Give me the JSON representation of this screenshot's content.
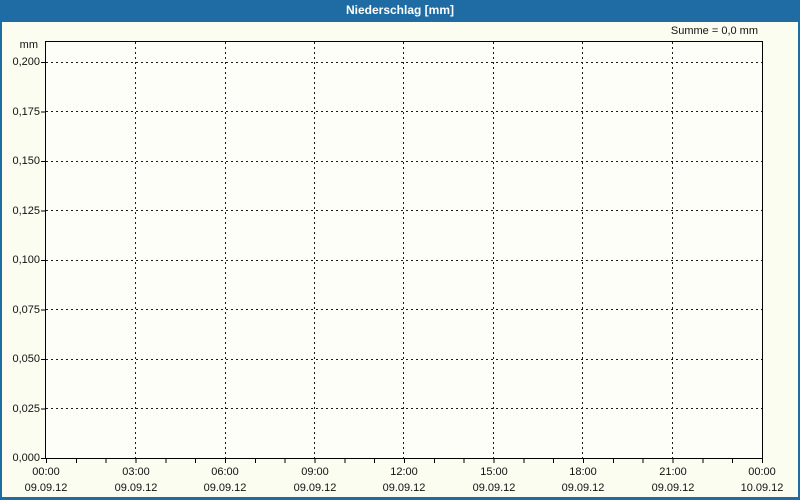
{
  "window": {
    "title": "Niederschlag [mm]"
  },
  "summary": {
    "text": "Summe = 0,0 mm"
  },
  "colors": {
    "accent_blue": "#1e6ca3",
    "content_background": "#fbfdf1",
    "plot_background": "#fdfef8",
    "grid": "#1a1a1a",
    "text": "#111111"
  },
  "chart_data": {
    "type": "bar",
    "title": "Niederschlag [mm]",
    "ylabel": "mm",
    "ylim": [
      0.0,
      0.2
    ],
    "y_tick_step": 0.025,
    "grid": "dashed major grid, horizontal every 0,025 mm, vertical every 3 hours; minor hourly tick marks on x axis",
    "legend_position": "none",
    "x_range": [
      "09.09.12 00:00",
      "10.09.12 00:00"
    ],
    "values": [],
    "sum_mm": "0,0",
    "note": "No precipitation recorded in the period; plot area is empty and Summe = 0,0 mm",
    "y_tick_labels_desc": [
      "0,200",
      "0,175",
      "0,150",
      "0,125",
      "0,100",
      "0,075",
      "0,050",
      "0,025",
      "0,000"
    ],
    "x_ticks": [
      {
        "time": "00:00",
        "date": "09.09.12"
      },
      {
        "time": "03:00",
        "date": "09.09.12"
      },
      {
        "time": "06:00",
        "date": "09.09.12"
      },
      {
        "time": "09:00",
        "date": "09.09.12"
      },
      {
        "time": "12:00",
        "date": "09.09.12"
      },
      {
        "time": "15:00",
        "date": "09.09.12"
      },
      {
        "time": "18:00",
        "date": "09.09.12"
      },
      {
        "time": "21:00",
        "date": "09.09.12"
      },
      {
        "time": "00:00",
        "date": "10.09.12"
      }
    ]
  }
}
